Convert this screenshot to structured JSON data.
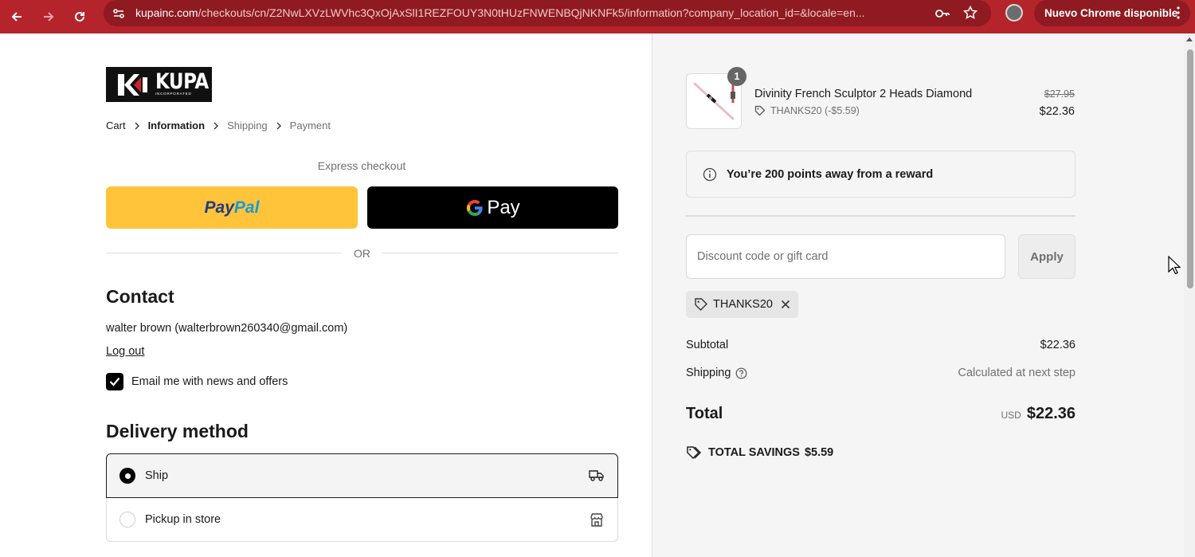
{
  "browser": {
    "url_host": "kupainc.com",
    "url_path": "/checkouts/cn/Z2NwLXVzLWVhc3QxOjAxSlI1REZFOUY3N0tHUzFNWENBQjNKNFk5/information?company_location_id=&locale=en...",
    "update_label": "Nuevo Chrome disponible"
  },
  "brand": {
    "logo_text": "KUPA",
    "logo_subtext": "INCORPORATED"
  },
  "breadcrumbs": [
    "Cart",
    "Information",
    "Shipping",
    "Payment"
  ],
  "express": {
    "label": "Express checkout",
    "paypal_pay": "Pay",
    "paypal_pal": "Pal",
    "gpay_label": "Pay",
    "or": "OR"
  },
  "contact": {
    "title": "Contact",
    "user": "walter brown (walterbrown260340@gmail.com)",
    "logout": "Log out",
    "newsletter_label": "Email me with news and offers",
    "newsletter_checked": true
  },
  "delivery": {
    "title": "Delivery method",
    "options": [
      {
        "label": "Ship",
        "selected": true,
        "icon": "truck-icon"
      },
      {
        "label": "Pickup in store",
        "selected": false,
        "icon": "store-icon"
      }
    ]
  },
  "summary": {
    "item": {
      "name": "Divinity French Sculptor 2 Heads Diamond",
      "quantity": "1",
      "discount_code": "THANKS20 (-$5.59)",
      "price_original": "$27.95",
      "price_final": "$22.36"
    },
    "reward_text": "You’re 200 points away from a reward",
    "discount_placeholder": "Discount code or gift card",
    "apply_label": "Apply",
    "applied_code": "THANKS20",
    "subtotal_label": "Subtotal",
    "subtotal_value": "$22.36",
    "shipping_label": "Shipping",
    "shipping_value": "Calculated at next step",
    "total_label": "Total",
    "total_currency": "USD",
    "total_value": "$22.36",
    "savings_label": "TOTAL SAVINGS",
    "savings_value": "$5.59"
  },
  "colors": {
    "chrome_bar": "#b5232b",
    "paypal_yellow": "#ffc439",
    "gpay_black": "#000000",
    "summary_bg": "#f5f5f5"
  }
}
